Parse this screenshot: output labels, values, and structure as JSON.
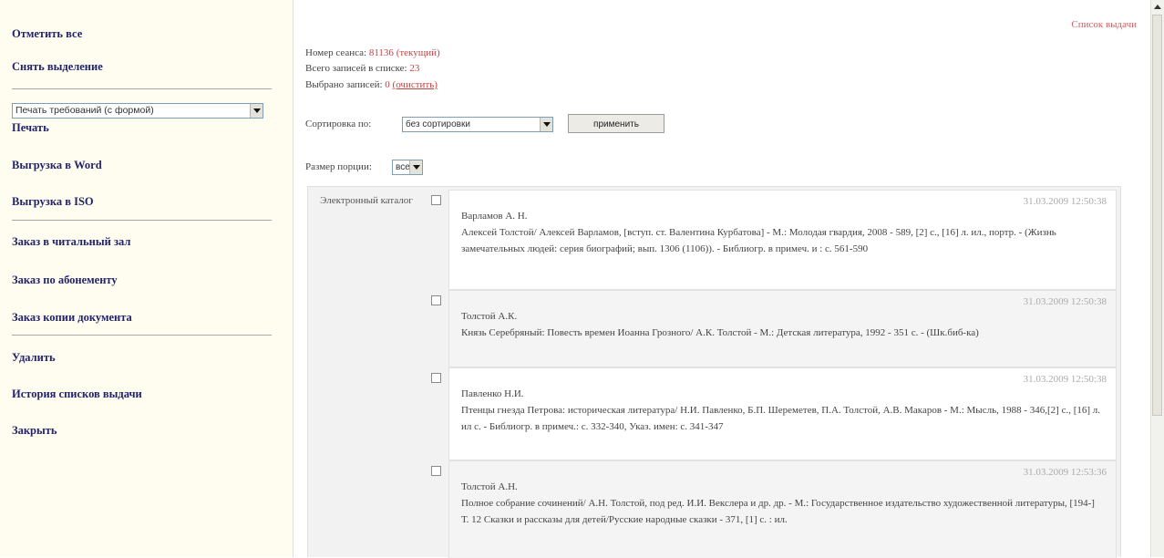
{
  "sidebar": {
    "select_all": "Отметить все",
    "deselect": "Снять выделение",
    "print_select": "Печать требований (с формой)",
    "print": "Печать",
    "export_word": "Выгрузка в Word",
    "export_iso": "Выгрузка в ISO",
    "order_reading_room": "Заказ в читальный зал",
    "order_subscription": "Заказ по абонементу",
    "order_copy": "Заказ копии документа",
    "delete": "Удалить",
    "history": "История списков выдачи",
    "close": "Закрыть"
  },
  "main": {
    "issue_list_link": "Список выдачи",
    "session_label": "Номер сеанса:",
    "session_number": "81136",
    "session_current": "(текущий)",
    "total_label": "Всего записей в списке:",
    "total_count": "23",
    "selected_label": "Выбрано записей:",
    "selected_count": "0",
    "selected_clear": "(очистить)",
    "sort_label": "Сортировка по:",
    "sort_value": "без сортировки",
    "apply_button": "применить",
    "portion_label": "Размер порции:",
    "portion_value": "все",
    "catalog_label": "Электронный каталог"
  },
  "records": [
    {
      "timestamp": "31.03.2009 12:50:38",
      "author": "Варламов А. Н.",
      "description": "Алексей Толстой/ Алексей Варламов, [вступ. ст. Валентина Курбатова] - М.: Молодая гвардия, 2008 - 589, [2] с., [16] л. ил., портр. - (Жизнь замечательных людей: серия биографий; вып. 1306 (1106)). - Библиогр. в примеч. и : с. 561-590",
      "extra": ""
    },
    {
      "timestamp": "31.03.2009 12:50:38",
      "author": "Толстой А.К.",
      "description": "Князь Серебряный: Повесть времен Иоанна Грозного/ А.К. Толстой - М.: Детская литература, 1992 - 351 с. - (Шк.биб-ка)",
      "extra": ""
    },
    {
      "timestamp": "31.03.2009 12:50:38",
      "author": "Павленко Н.И.",
      "description": "Птенцы гнезда Петрова: историческая литература/ Н.И. Павленко, Б.П. Шереметев, П.А. Толстой, А.В. Макаров - М.: Мысль, 1988 - 346,[2] с., [16] л. ил с. - Библиогр. в примеч.: с. 332-340, Указ. имен: с. 341-347",
      "extra": ""
    },
    {
      "timestamp": "31.03.2009 12:53:36",
      "author": "Толстой А.Н.",
      "description": "Полное собрание сочинений/ А.Н. Толстой, под ред. И.И. Векслера и др. др. - М.: Государственное издательство художественной литературы, [194-]",
      "extra": "Т. 12 Сказки и рассказы для детей/Русские народные сказки - 371, [1] с. : ил."
    }
  ]
}
